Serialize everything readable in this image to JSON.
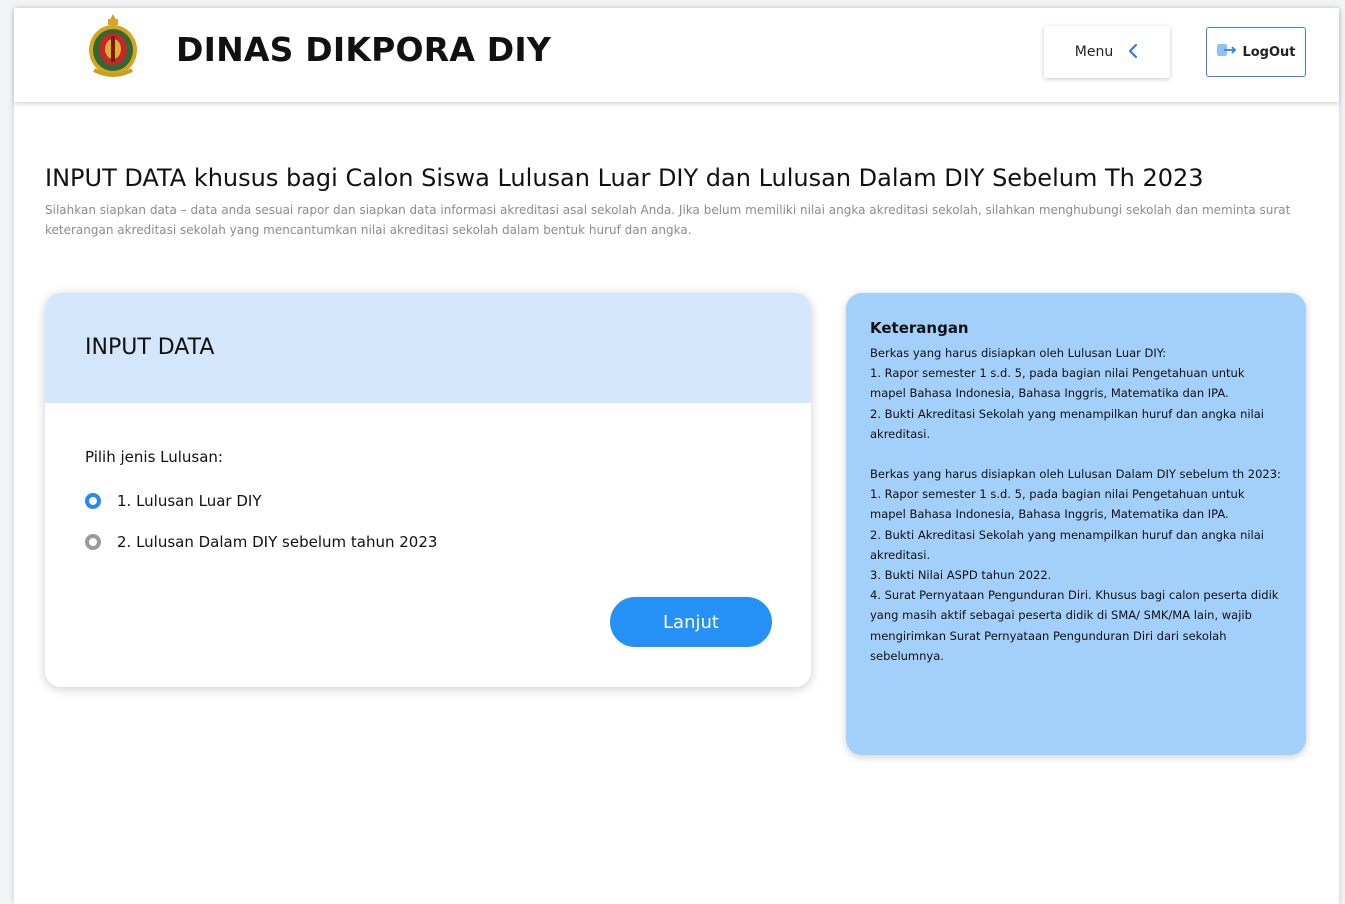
{
  "header": {
    "logo": "dikpora-diy-crest",
    "title": "DINAS DIKPORA DIY",
    "menu_label": "Menu",
    "menu_icon": "chevron-left-icon",
    "logout_label": "LogOut",
    "logout_icon": "logout-icon"
  },
  "page": {
    "title": "INPUT DATA khusus bagi Calon Siswa Lulusan Luar DIY dan Lulusan Dalam DIY Sebelum Th 2023",
    "description": "Silahkan siapkan data – data anda sesuai rapor dan siapkan data informasi akreditasi asal sekolah Anda. Jika belum memiliki nilai angka akreditasi sekolah, silahkan menghubungi sekolah dan meminta surat keterangan akreditasi sekolah yang mencantumkan nilai akreditasi sekolah dalam bentuk huruf dan angka."
  },
  "form": {
    "title": "INPUT DATA",
    "prompt": "Pilih jenis Lulusan:",
    "options": [
      {
        "label": "1. Lulusan Luar DIY",
        "selected": true
      },
      {
        "label": "2. Lulusan Dalam DIY sebelum tahun 2023",
        "selected": false
      }
    ],
    "submit_label": "Lanjut"
  },
  "info": {
    "title": "Keterangan",
    "group1": [
      "Berkas yang harus disiapkan oleh Lulusan Luar DIY:",
      "1. Rapor semester 1 s.d. 5, pada bagian nilai Pengetahuan untuk mapel Bahasa Indonesia, Bahasa Inggris, Matematika dan IPA.",
      "2. Bukti Akreditasi Sekolah yang menampilkan huruf dan angka nilai akreditasi."
    ],
    "group2": [
      "Berkas yang harus disiapkan oleh Lulusan Dalam DIY sebelum th 2023:",
      "1. Rapor semester 1 s.d. 5, pada bagian nilai Pengetahuan untuk mapel Bahasa Indonesia, Bahasa Inggris, Matematika dan IPA.",
      "2. Bukti Akreditasi Sekolah yang menampilkan huruf dan angka nilai akreditasi.",
      "3. Bukti Nilai ASPD tahun 2022.",
      "4. Surat Pernyataan Pengunduran Diri. Khusus bagi calon peserta didik yang masih aktif sebagai peserta didik di SMA/ SMK/MA lain, wajib mengirimkan Surat Pernyataan Pengunduran Diri dari sekolah sebelumnya."
    ]
  },
  "colors": {
    "accent": "#2590f6",
    "card_header": "#d3e6fc",
    "info_panel": "#a3d0fb"
  }
}
